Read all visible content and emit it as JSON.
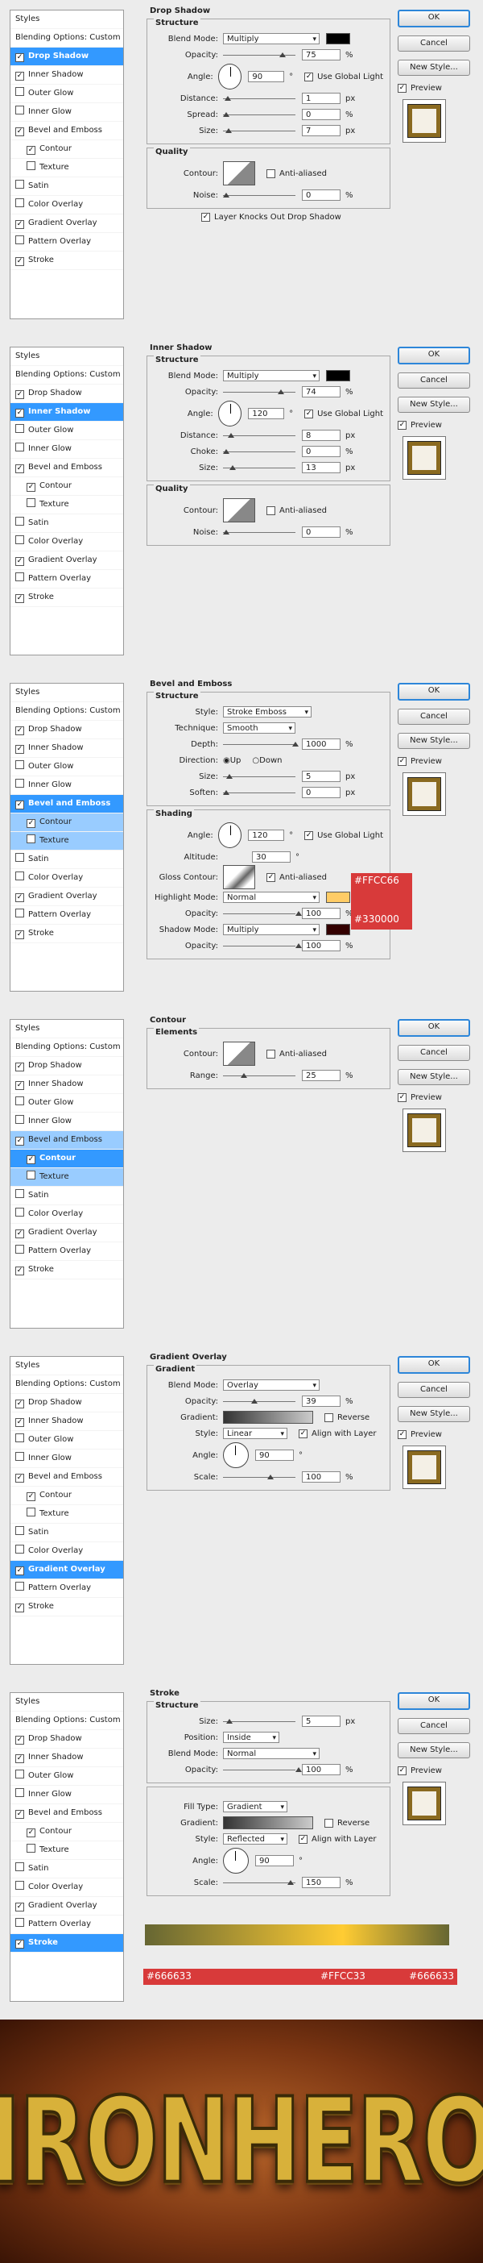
{
  "sidebar": {
    "header": "Styles",
    "blending": "Blending Options: Custom",
    "items": [
      "Drop Shadow",
      "Inner Shadow",
      "Outer Glow",
      "Inner Glow",
      "Bevel and Emboss",
      "Contour",
      "Texture",
      "Satin",
      "Color Overlay",
      "Gradient Overlay",
      "Pattern Overlay",
      "Stroke"
    ]
  },
  "buttons": {
    "ok": "OK",
    "cancel": "Cancel",
    "new_style": "New Style...",
    "preview": "Preview"
  },
  "panels": [
    {
      "title": "Drop Shadow",
      "structure": "Structure",
      "blend_mode_label": "Blend Mode:",
      "blend_mode": "Multiply",
      "opacity_label": "Opacity:",
      "opacity": "75",
      "angle_label": "Angle:",
      "angle": "90",
      "use_global": "Use Global Light",
      "distance_label": "Distance:",
      "distance": "1",
      "spread_label": "Spread:",
      "spread": "0",
      "size_label": "Size:",
      "size": "7",
      "quality": "Quality",
      "contour_label": "Contour:",
      "anti_aliased": "Anti-aliased",
      "noise_label": "Noise:",
      "noise": "0",
      "knocks": "Layer Knocks Out Drop Shadow"
    },
    {
      "title": "Inner Shadow",
      "structure": "Structure",
      "blend_mode_label": "Blend Mode:",
      "blend_mode": "Multiply",
      "opacity_label": "Opacity:",
      "opacity": "74",
      "angle_label": "Angle:",
      "angle": "120",
      "use_global": "Use Global Light",
      "distance_label": "Distance:",
      "distance": "8",
      "choke_label": "Choke:",
      "choke": "0",
      "size_label": "Size:",
      "size": "13",
      "quality": "Quality",
      "contour_label": "Contour:",
      "anti_aliased": "Anti-aliased",
      "noise_label": "Noise:",
      "noise": "0"
    },
    {
      "title": "Bevel and Emboss",
      "structure": "Structure",
      "style_label": "Style:",
      "style": "Stroke Emboss",
      "technique_label": "Technique:",
      "technique": "Smooth",
      "depth_label": "Depth:",
      "depth": "1000",
      "direction_label": "Direction:",
      "up": "Up",
      "down": "Down",
      "size_label": "Size:",
      "size": "5",
      "soften_label": "Soften:",
      "soften": "0",
      "shading": "Shading",
      "angle_label": "Angle:",
      "angle": "120",
      "use_global": "Use Global Light",
      "altitude_label": "Altitude:",
      "altitude": "30",
      "gloss_label": "Gloss Contour:",
      "anti_aliased": "Anti-aliased",
      "highlight_label": "Highlight Mode:",
      "highlight_mode": "Normal",
      "highlight_color": "#FFCC66",
      "hl_opacity_label": "Opacity:",
      "hl_opacity": "100",
      "shadow_label": "Shadow Mode:",
      "shadow_mode": "Multiply",
      "shadow_color": "#330000",
      "sh_opacity_label": "Opacity:",
      "sh_opacity": "100"
    },
    {
      "title": "Contour",
      "elements": "Elements",
      "contour_label": "Contour:",
      "anti_aliased": "Anti-aliased",
      "range_label": "Range:",
      "range": "25"
    },
    {
      "title": "Gradient Overlay",
      "gradient": "Gradient",
      "blend_mode_label": "Blend Mode:",
      "blend_mode": "Overlay",
      "opacity_label": "Opacity:",
      "opacity": "39",
      "gradient_label": "Gradient:",
      "reverse": "Reverse",
      "style_label": "Style:",
      "style": "Linear",
      "align": "Align with Layer",
      "angle_label": "Angle:",
      "angle": "90",
      "scale_label": "Scale:",
      "scale": "100"
    },
    {
      "title": "Stroke",
      "structure": "Structure",
      "size_label": "Size:",
      "size": "5",
      "position_label": "Position:",
      "position": "Inside",
      "blend_mode_label": "Blend Mode:",
      "blend_mode": "Normal",
      "opacity_label": "Opacity:",
      "opacity": "100",
      "fill_type_label": "Fill Type:",
      "fill_type": "Gradient",
      "gradient_label": "Gradient:",
      "reverse": "Reverse",
      "style_label": "Style:",
      "style": "Reflected",
      "align": "Align with Layer",
      "angle_label": "Angle:",
      "angle": "90",
      "scale_label": "Scale:",
      "scale": "150",
      "stop_left": "#666633",
      "stop_mid": "#FFCC33",
      "stop_right": "#666633"
    }
  ],
  "artwork": {
    "text": "IRONHERO"
  },
  "colors": {
    "highlight": "#ffcc66",
    "shadow": "#330000",
    "selection": "#3399ff"
  }
}
